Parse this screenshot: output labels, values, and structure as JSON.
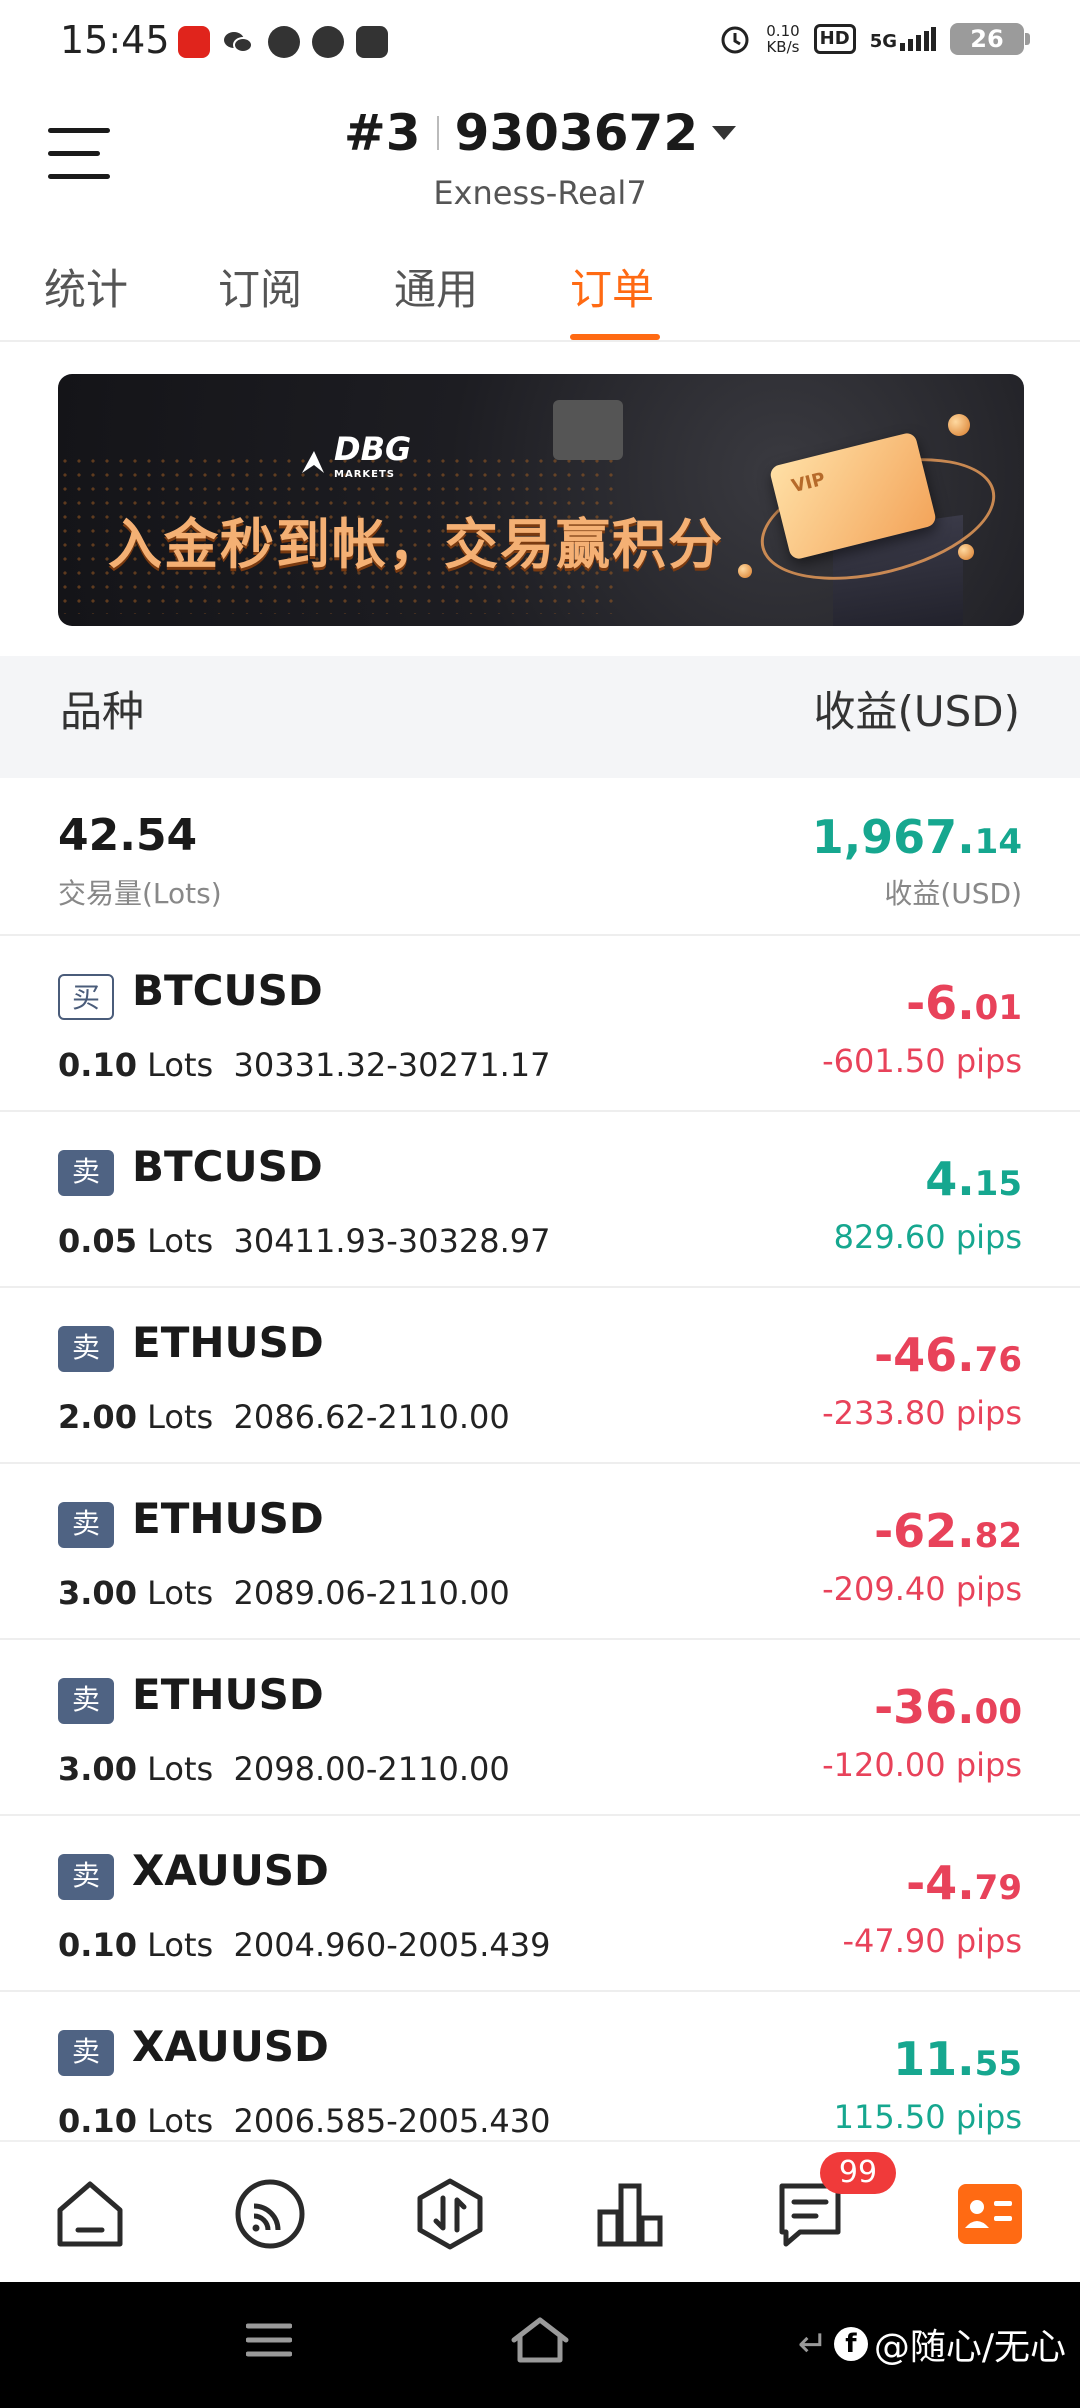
{
  "status_bar": {
    "time": "15:45",
    "net_speed": "0.10",
    "net_unit": "KB/s",
    "hd_label": "HD",
    "signal_label": "5G",
    "battery": "26",
    "app_icons": [
      "news-app-icon",
      "wechat-icon",
      "media-play-icon",
      "compass-icon",
      "video-app-icon"
    ]
  },
  "header": {
    "account_prefix": "#3",
    "account_number": "9303672",
    "server": "Exness-Real7"
  },
  "tabs": [
    {
      "label": "统计",
      "active": false
    },
    {
      "label": "订阅",
      "active": false
    },
    {
      "label": "通用",
      "active": false
    },
    {
      "label": "订单",
      "active": true
    }
  ],
  "banner": {
    "logo_text": "DBG",
    "logo_sub": "MARKETS",
    "headline": "入金秒到帐，交易赢积分"
  },
  "table_header": {
    "symbol_label": "品种",
    "profit_label": "收益(USD)"
  },
  "summary": {
    "total_lots": "42.54",
    "lots_label": "交易量(Lots)",
    "total_profit_int": "1,967.",
    "total_profit_dec": "14",
    "profit_label": "收益(USD)"
  },
  "orders": [
    {
      "side": "买",
      "side_type": "buy",
      "symbol": "BTCUSD",
      "lots": "0.10",
      "lots_unit": "Lots",
      "prices": "30331.32-30271.17",
      "profit_int": "-6.",
      "profit_dec": "01",
      "pips": "-601.50 pips",
      "sign": "neg"
    },
    {
      "side": "卖",
      "side_type": "sell",
      "symbol": "BTCUSD",
      "lots": "0.05",
      "lots_unit": "Lots",
      "prices": "30411.93-30328.97",
      "profit_int": "4.",
      "profit_dec": "15",
      "pips": "829.60 pips",
      "sign": "pos"
    },
    {
      "side": "卖",
      "side_type": "sell",
      "symbol": "ETHUSD",
      "lots": "2.00",
      "lots_unit": "Lots",
      "prices": "2086.62-2110.00",
      "profit_int": "-46.",
      "profit_dec": "76",
      "pips": "-233.80 pips",
      "sign": "neg"
    },
    {
      "side": "卖",
      "side_type": "sell",
      "symbol": "ETHUSD",
      "lots": "3.00",
      "lots_unit": "Lots",
      "prices": "2089.06-2110.00",
      "profit_int": "-62.",
      "profit_dec": "82",
      "pips": "-209.40 pips",
      "sign": "neg"
    },
    {
      "side": "卖",
      "side_type": "sell",
      "symbol": "ETHUSD",
      "lots": "3.00",
      "lots_unit": "Lots",
      "prices": "2098.00-2110.00",
      "profit_int": "-36.",
      "profit_dec": "00",
      "pips": "-120.00 pips",
      "sign": "neg"
    },
    {
      "side": "卖",
      "side_type": "sell",
      "symbol": "XAUUSD",
      "lots": "0.10",
      "lots_unit": "Lots",
      "prices": "2004.960-2005.439",
      "profit_int": "-4.",
      "profit_dec": "79",
      "pips": "-47.90 pips",
      "sign": "neg"
    },
    {
      "side": "卖",
      "side_type": "sell",
      "symbol": "XAUUSD",
      "lots": "0.10",
      "lots_unit": "Lots",
      "prices": "2006.585-2005.430",
      "profit_int": "11.",
      "profit_dec": "55",
      "pips": "115.50 pips",
      "sign": "pos"
    }
  ],
  "bottom_nav": {
    "items": [
      "home-icon",
      "signal-feed-icon",
      "trade-icon",
      "chart-bars-icon",
      "messages-icon",
      "profile-card-icon"
    ],
    "message_badge": "99",
    "active_color": "#ff6a13"
  },
  "watermark": {
    "text": "@随心/无心"
  },
  "colors": {
    "accent": "#ff6a13",
    "profit_positive": "#16a78f",
    "profit_negative": "#e8425a",
    "sell_badge": "#4f6383"
  }
}
